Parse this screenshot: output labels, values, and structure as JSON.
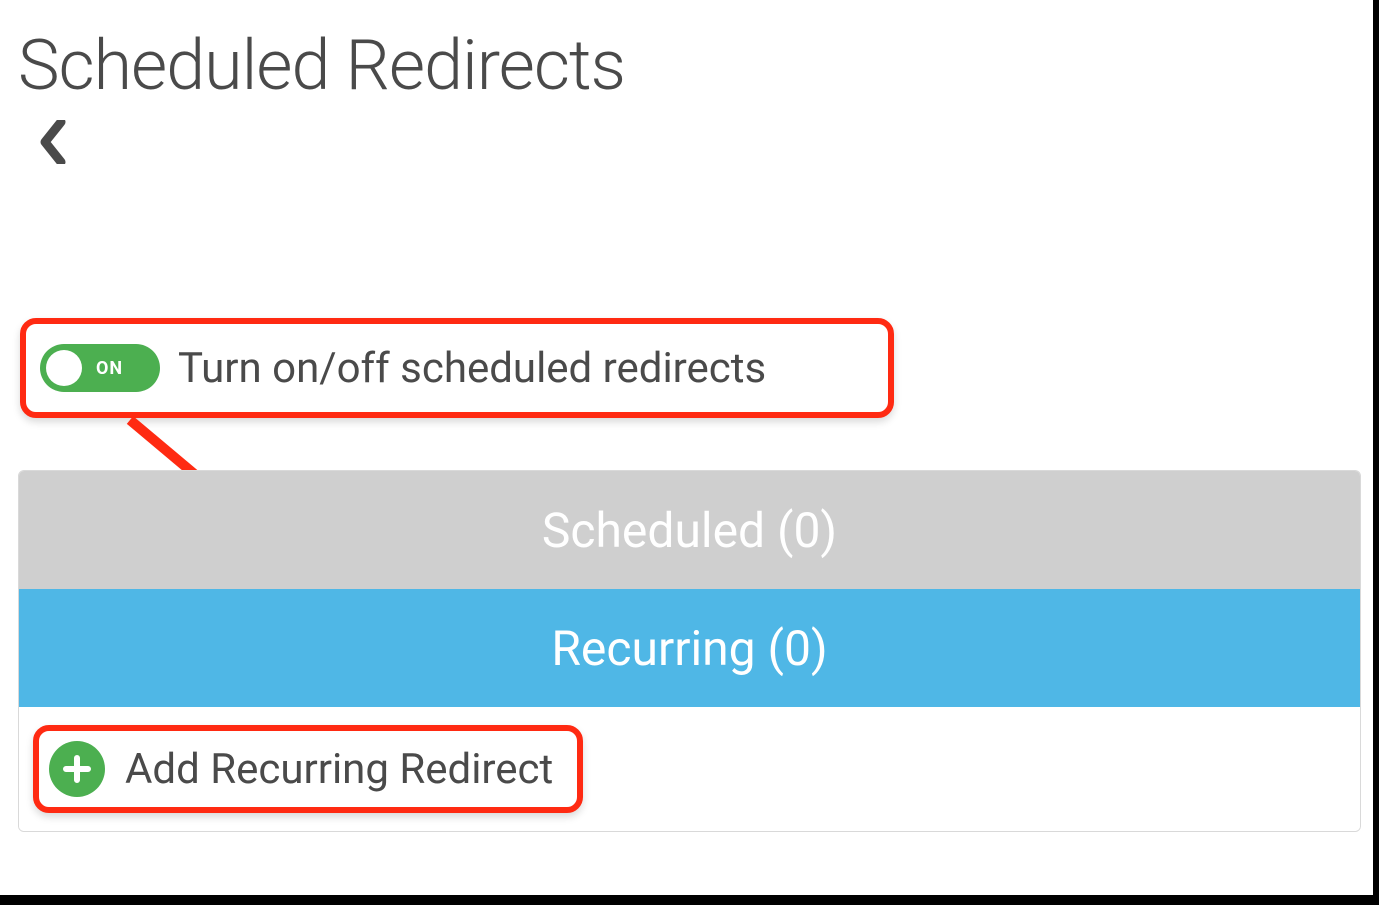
{
  "page": {
    "title": "Scheduled Redirects"
  },
  "toggle": {
    "state": "ON",
    "label": "Turn on/off scheduled redirects",
    "on": true
  },
  "tabs": {
    "scheduled": {
      "label": "Scheduled (0)",
      "count": 0
    },
    "recurring": {
      "label": "Recurring (0)",
      "count": 0,
      "active": true
    }
  },
  "add": {
    "label": "Add Recurring Redirect"
  },
  "icons": {
    "back": "chevron-left-icon",
    "plus": "plus-icon"
  },
  "colors": {
    "highlight": "#ff2a12",
    "toggle_on": "#4caf50",
    "tab_inactive": "#cfcfcf",
    "tab_active": "#4fb7e6"
  }
}
